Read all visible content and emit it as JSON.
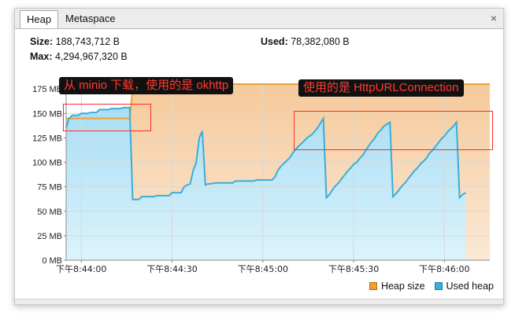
{
  "tabs": [
    {
      "label": "Heap",
      "active": true
    },
    {
      "label": "Metaspace",
      "active": false
    }
  ],
  "close_symbol": "×",
  "stats": {
    "size_label": "Size:",
    "size_value": "188,743,712 B",
    "used_label": "Used:",
    "used_value": "78,382,080 B",
    "max_label": "Max:",
    "max_value": "4,294,967,320 B"
  },
  "legend": [
    {
      "label": "Heap size",
      "color": "#f0a030"
    },
    {
      "label": "Used heap",
      "color": "#3aaed8"
    }
  ],
  "annotations": {
    "left": "从 minio 下载，使用的是 okhttp",
    "right": "使用的是 HttpURLConnection"
  },
  "colors": {
    "heap_fill": "#f6d6b3",
    "used_fill": "#c5ecfa",
    "used_line": "#3aaed8",
    "heap_line": "#f0a030",
    "highlight": "#ff2a2a"
  },
  "chart_data": {
    "type": "area",
    "y_unit": "MB",
    "ylim": [
      0,
      180
    ],
    "xlim": [
      0,
      140
    ],
    "y_ticks": [
      {
        "value": 0,
        "label": "0 MB"
      },
      {
        "value": 25,
        "label": "25 MB"
      },
      {
        "value": 50,
        "label": "50 MB"
      },
      {
        "value": 75,
        "label": "75 MB"
      },
      {
        "value": 100,
        "label": "100 MB"
      },
      {
        "value": 125,
        "label": "125 MB"
      },
      {
        "value": 150,
        "label": "150 MB"
      },
      {
        "value": 175,
        "label": "175 MB"
      }
    ],
    "x_ticks": [
      {
        "t": 5,
        "label": "下午8:44:00"
      },
      {
        "t": 35,
        "label": "下午8:44:30"
      },
      {
        "t": 65,
        "label": "下午8:45:00"
      },
      {
        "t": 95,
        "label": "下午8:45:30"
      },
      {
        "t": 125,
        "label": "下午8:46:00"
      }
    ],
    "grid": true,
    "legend_position": "bottom-right",
    "series": [
      {
        "name": "Heap size",
        "points": [
          [
            0,
            145
          ],
          [
            21,
            145
          ],
          [
            22,
            175
          ],
          [
            23,
            180
          ],
          [
            140,
            180
          ]
        ]
      },
      {
        "name": "Used heap",
        "points": [
          [
            0,
            135
          ],
          [
            1,
            145
          ],
          [
            2,
            148
          ],
          [
            4,
            148
          ],
          [
            5,
            150
          ],
          [
            7,
            150
          ],
          [
            8,
            151
          ],
          [
            10,
            151
          ],
          [
            11,
            154
          ],
          [
            14,
            154
          ],
          [
            15,
            155
          ],
          [
            18,
            155
          ],
          [
            19,
            156
          ],
          [
            21,
            156
          ],
          [
            22,
            62
          ],
          [
            24,
            62
          ],
          [
            25,
            65
          ],
          [
            29,
            65
          ],
          [
            30,
            66
          ],
          [
            34,
            66
          ],
          [
            35,
            69
          ],
          [
            38,
            69
          ],
          [
            39,
            75
          ],
          [
            40,
            77
          ],
          [
            41,
            78
          ],
          [
            42,
            92
          ],
          [
            43,
            100
          ],
          [
            44,
            125
          ],
          [
            45,
            132
          ],
          [
            46,
            77
          ],
          [
            47,
            78
          ],
          [
            48,
            78
          ],
          [
            49,
            79
          ],
          [
            55,
            79
          ],
          [
            56,
            81
          ],
          [
            62,
            81
          ],
          [
            63,
            82
          ],
          [
            68,
            82
          ],
          [
            69,
            85
          ],
          [
            70,
            92
          ],
          [
            71,
            96
          ],
          [
            72,
            99
          ],
          [
            73,
            102
          ],
          [
            74,
            105
          ],
          [
            75,
            110
          ],
          [
            76,
            114
          ],
          [
            77,
            117
          ],
          [
            78,
            120
          ],
          [
            79,
            123
          ],
          [
            80,
            126
          ],
          [
            81,
            128
          ],
          [
            82,
            131
          ],
          [
            83,
            135
          ],
          [
            84,
            140
          ],
          [
            85,
            145
          ],
          [
            86,
            64
          ],
          [
            87,
            67
          ],
          [
            88,
            72
          ],
          [
            89,
            76
          ],
          [
            90,
            79
          ],
          [
            91,
            83
          ],
          [
            92,
            87
          ],
          [
            93,
            91
          ],
          [
            94,
            94
          ],
          [
            95,
            98
          ],
          [
            96,
            100
          ],
          [
            97,
            104
          ],
          [
            98,
            107
          ],
          [
            99,
            112
          ],
          [
            100,
            117
          ],
          [
            101,
            121
          ],
          [
            102,
            125
          ],
          [
            103,
            130
          ],
          [
            104,
            133
          ],
          [
            105,
            137
          ],
          [
            106,
            139
          ],
          [
            107,
            141
          ],
          [
            108,
            65
          ],
          [
            109,
            68
          ],
          [
            110,
            72
          ],
          [
            111,
            76
          ],
          [
            112,
            79
          ],
          [
            113,
            83
          ],
          [
            114,
            87
          ],
          [
            115,
            91
          ],
          [
            116,
            94
          ],
          [
            117,
            98
          ],
          [
            118,
            101
          ],
          [
            119,
            104
          ],
          [
            120,
            109
          ],
          [
            121,
            112
          ],
          [
            122,
            116
          ],
          [
            123,
            120
          ],
          [
            124,
            124
          ],
          [
            125,
            127
          ],
          [
            126,
            131
          ],
          [
            127,
            134
          ],
          [
            128,
            137
          ],
          [
            129,
            141
          ],
          [
            130,
            64
          ],
          [
            131,
            67
          ],
          [
            132,
            69
          ]
        ]
      }
    ]
  }
}
